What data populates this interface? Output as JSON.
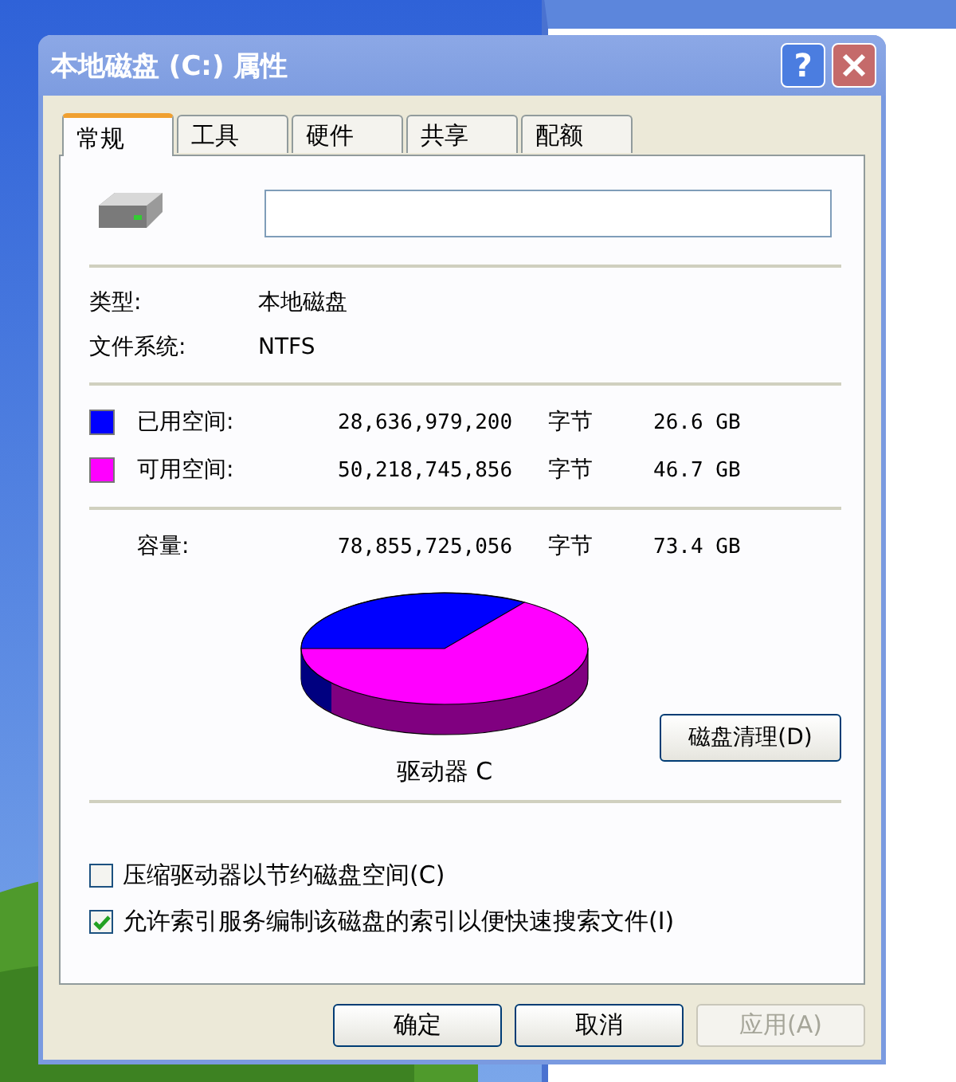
{
  "window": {
    "title": "本地磁盘 (C:) 属性",
    "help_button": "?"
  },
  "tabs": [
    {
      "label": "常规",
      "selected": true
    },
    {
      "label": "工具",
      "selected": false
    },
    {
      "label": "硬件",
      "selected": false
    },
    {
      "label": "共享",
      "selected": false
    },
    {
      "label": "配额",
      "selected": false
    }
  ],
  "info": [
    {
      "label": "类型:",
      "value": "本地磁盘"
    },
    {
      "label": "文件系统:",
      "value": "NTFS"
    }
  ],
  "space": [
    {
      "label": "已用空间:",
      "bytes": "28,636,979,200",
      "unit": "字节",
      "size": "26.6 GB",
      "color": "#0000ff"
    },
    {
      "label": "可用空间:",
      "bytes": "50,218,745,856",
      "unit": "字节",
      "size": "46.7 GB",
      "color": "#ff00ff"
    }
  ],
  "capacity": {
    "label": "容量:",
    "bytes": "78,855,725,056",
    "unit": "字节",
    "size": "73.4 GB"
  },
  "drive_label": "驱动器 C",
  "cleanup_button": "磁盘清理(D)",
  "options": [
    {
      "label": "压缩驱动器以节约磁盘空间(C)",
      "checked": false
    },
    {
      "label": "允许索引服务编制该磁盘的索引以便快速搜索文件(I)",
      "checked": true
    }
  ],
  "buttons": [
    {
      "label": "确定",
      "disabled": false
    },
    {
      "label": "取消",
      "disabled": false
    },
    {
      "label": "应用(A)",
      "disabled": true
    }
  ]
}
